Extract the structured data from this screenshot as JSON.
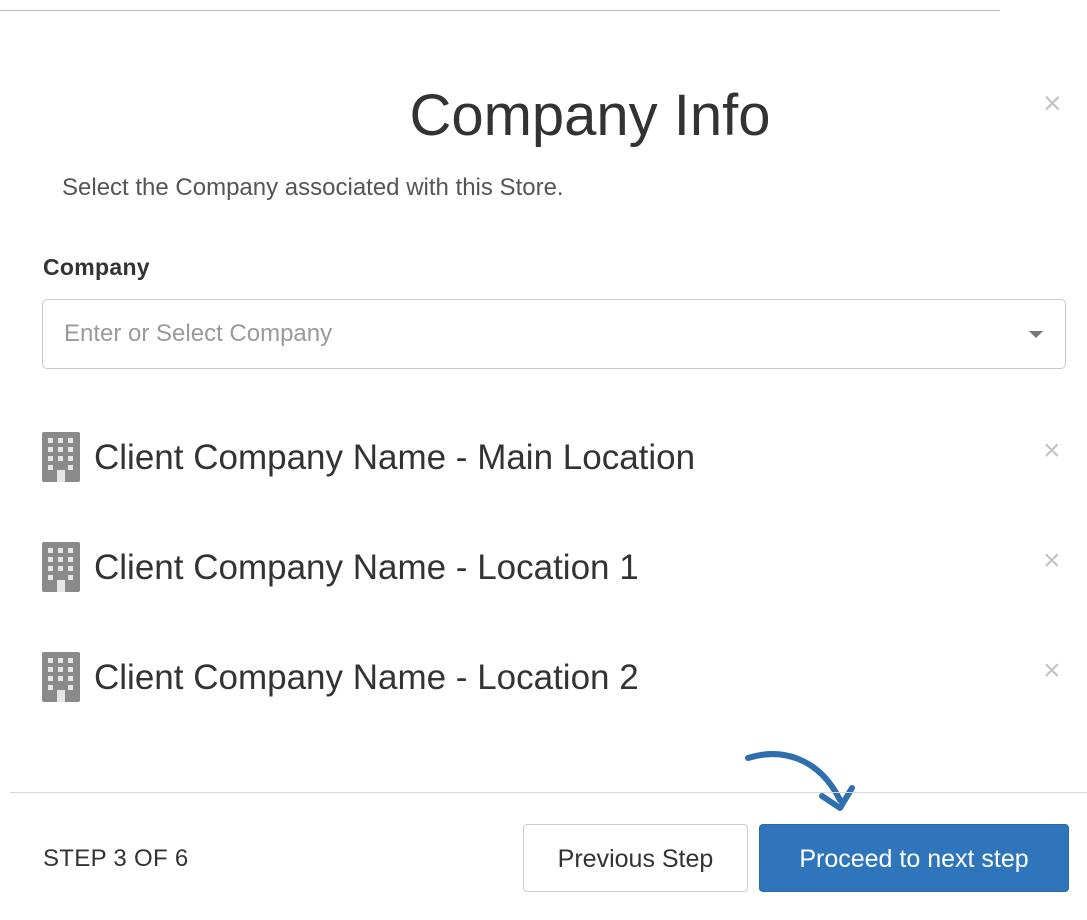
{
  "modal": {
    "title": "Company Info",
    "subtitle": "Select the Company associated with this Store.",
    "close_glyph": "×"
  },
  "company_field": {
    "label": "Company",
    "placeholder": "Enter or Select Company",
    "caret_icon": "caret-down-icon"
  },
  "companies": [
    {
      "icon": "building-icon",
      "name": "Client Company Name - Main Location",
      "remove_glyph": "×"
    },
    {
      "icon": "building-icon",
      "name": "Client Company Name - Location 1",
      "remove_glyph": "×"
    },
    {
      "icon": "building-icon",
      "name": "Client Company Name - Location 2",
      "remove_glyph": "×"
    }
  ],
  "footer": {
    "step_text": "STEP 3 OF 6",
    "previous_label": "Previous Step",
    "next_label": "Proceed to next step"
  },
  "colors": {
    "primary": "#2f75bb",
    "arrow": "#2f6fad",
    "icon_gray": "#8a8a8a",
    "close_gray": "#c4c4c4"
  }
}
